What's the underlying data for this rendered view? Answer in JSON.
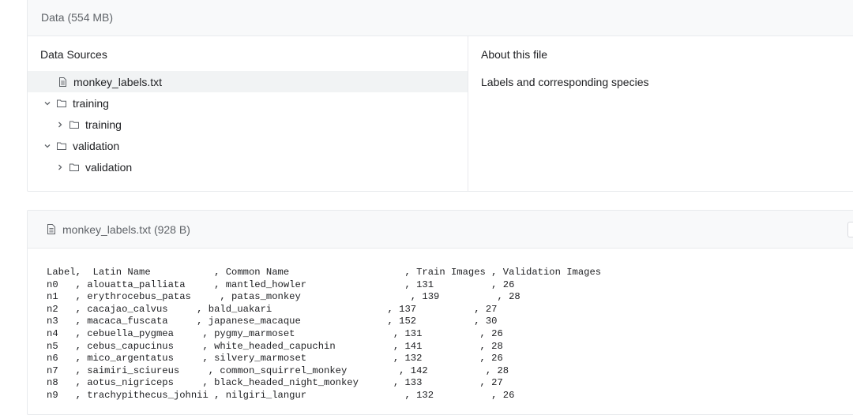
{
  "data_panel": {
    "header": "Data (554 MB)",
    "sources_title": "Data Sources",
    "about_title": "About this file",
    "about_description": "Labels and corresponding species",
    "tree": [
      {
        "label": "monkey_labels.txt",
        "type": "file",
        "expanded": null,
        "selected": true,
        "level": 1
      },
      {
        "label": "training",
        "type": "folder",
        "expanded": true,
        "selected": false,
        "level": 0
      },
      {
        "label": "training",
        "type": "folder",
        "expanded": false,
        "selected": false,
        "level": 1
      },
      {
        "label": "validation",
        "type": "folder",
        "expanded": true,
        "selected": false,
        "level": 0
      },
      {
        "label": "validation",
        "type": "folder",
        "expanded": false,
        "selected": false,
        "level": 1
      }
    ]
  },
  "file_preview": {
    "header": "monkey_labels.txt (928 B)",
    "lines": [
      "Label,  Latin Name           , Common Name                    , Train Images , Validation Images",
      "n0   , alouatta_palliata\t     , mantled_howler                 , 131          , 26",
      "n1   , erythrocebus_patas\t     , patas_monkey                   , 139          , 28",
      "n2   , cacajao_calvus\t     , bald_uakari                    , 137          , 27",
      "n3   , macaca_fuscata\t     , japanese_macaque               , 152          , 30",
      "n4   , cebuella_pygmea\t     , pygmy_marmoset                 , 131          , 26",
      "n5   , cebus_capucinus\t     , white_headed_capuchin          , 141          , 28",
      "n6   , mico_argentatus\t     , silvery_marmoset               , 132          , 26",
      "n7   , saimiri_sciureus\t     , common_squirrel_monkey         , 142          , 28",
      "n8   , aotus_nigriceps\t     , black_headed_night_monkey      , 133          , 27",
      "n9   , trachypithecus_johnii , nilgiri_langur                 , 132          , 26"
    ]
  },
  "icons": {
    "file": "file-text-icon",
    "folder": "folder-icon",
    "expanded": "chevron-down-icon",
    "collapsed": "chevron-right-icon"
  },
  "colors": {
    "border": "#e8eaed",
    "header_bg": "#f8f9fa",
    "selected_bg": "#f1f3f4",
    "muted_text": "#5f6368",
    "text": "#202124"
  }
}
